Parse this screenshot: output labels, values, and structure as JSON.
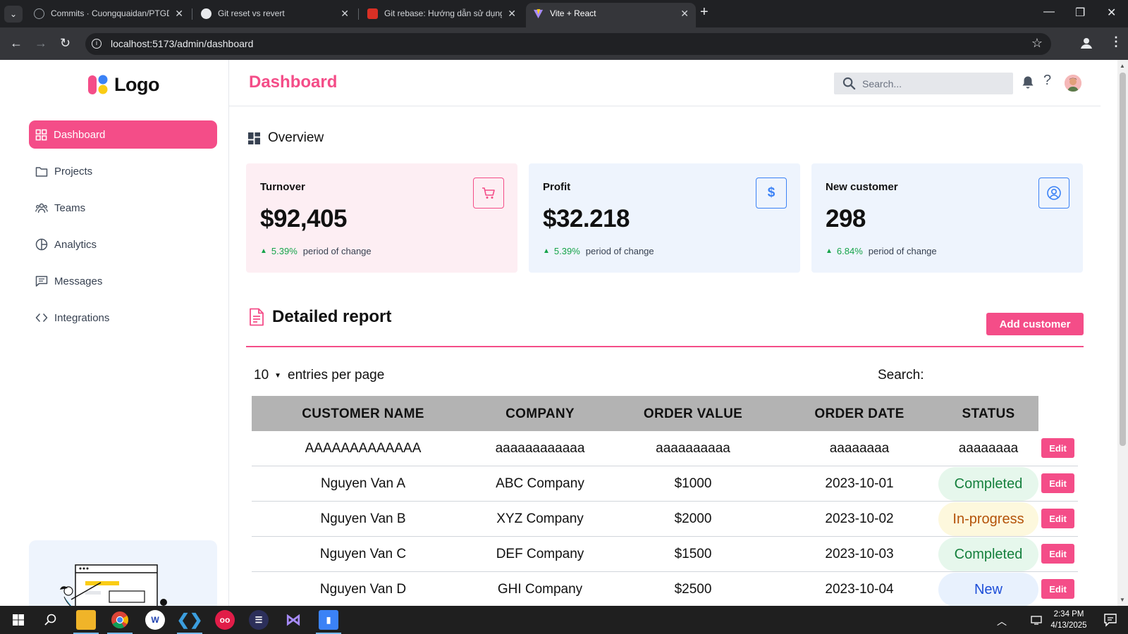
{
  "browser": {
    "tabs": [
      {
        "title": "Commits · Cuongquaidan/PTGD",
        "active": false
      },
      {
        "title": "Git reset vs revert",
        "active": false
      },
      {
        "title": "Git rebase: Hướng dẫn sử dụng",
        "active": false
      },
      {
        "title": "Vite + React",
        "active": true
      }
    ],
    "url": "localhost:5173/admin/dashboard"
  },
  "sidebar": {
    "logo_text": "Logo",
    "items": [
      {
        "label": "Dashboard",
        "icon": "grid-icon",
        "active": true
      },
      {
        "label": "Projects",
        "icon": "folder-icon",
        "active": false
      },
      {
        "label": "Teams",
        "icon": "users-icon",
        "active": false
      },
      {
        "label": "Analytics",
        "icon": "pie-chart-icon",
        "active": false
      },
      {
        "label": "Messages",
        "icon": "message-icon",
        "active": false
      },
      {
        "label": "Integrations",
        "icon": "code-icon",
        "active": false
      }
    ]
  },
  "header": {
    "title": "Dashboard",
    "search_placeholder": "Search..."
  },
  "overview": {
    "title": "Overview",
    "cards": [
      {
        "label": "Turnover",
        "value": "$92,405",
        "change": "5.39%",
        "note": "period of change",
        "icon": "cart-icon",
        "accent": "#f44d88"
      },
      {
        "label": "Profit",
        "value": "$32.218",
        "change": "5.39%",
        "note": "period of change",
        "icon": "dollar-icon",
        "accent": "#3b82f6"
      },
      {
        "label": "New customer",
        "value": "298",
        "change": "6.84%",
        "note": "period of change",
        "icon": "user-circle-icon",
        "accent": "#3b82f6"
      }
    ]
  },
  "report": {
    "title": "Detailed report",
    "add_button": "Add customer",
    "entries_value": "10",
    "entries_label": "entries per page",
    "search_label": "Search:",
    "columns": [
      "CUSTOMER NAME",
      "COMPANY",
      "ORDER VALUE",
      "ORDER DATE",
      "STATUS"
    ],
    "edit_label": "Edit",
    "rows": [
      {
        "name": "AAAAAAAAAAAAA",
        "company": "aaaaaaaaaaaa",
        "value": "aaaaaaaaaa",
        "date": "aaaaaaaa",
        "status": "aaaaaaaa",
        "status_kind": "plain"
      },
      {
        "name": "Nguyen Van A",
        "company": "ABC Company",
        "value": "$1000",
        "date": "2023-10-01",
        "status": "Completed",
        "status_kind": "completed"
      },
      {
        "name": "Nguyen Van B",
        "company": "XYZ Company",
        "value": "$2000",
        "date": "2023-10-02",
        "status": "In-progress",
        "status_kind": "progress"
      },
      {
        "name": "Nguyen Van C",
        "company": "DEF Company",
        "value": "$1500",
        "date": "2023-10-03",
        "status": "Completed",
        "status_kind": "completed"
      },
      {
        "name": "Nguyen Van D",
        "company": "GHI Company",
        "value": "$2500",
        "date": "2023-10-04",
        "status": "New",
        "status_kind": "new"
      }
    ]
  },
  "taskbar": {
    "time": "2:34 PM",
    "date": "4/13/2025"
  },
  "colors": {
    "brand": "#f44d88",
    "completed_bg": "#e6f7ec",
    "completed_fg": "#15803d",
    "progress_bg": "#fdf8dd",
    "progress_fg": "#b45309",
    "new_bg": "#e8f1fd",
    "new_fg": "#1d4ed8"
  }
}
